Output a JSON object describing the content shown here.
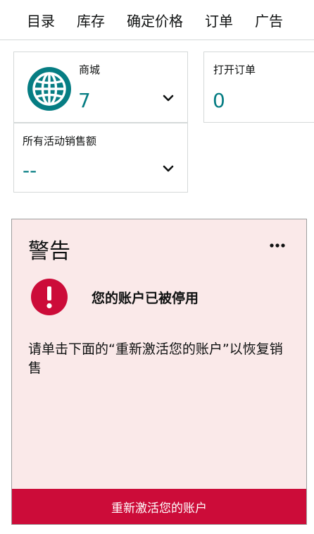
{
  "nav": {
    "items": [
      {
        "label": "目录"
      },
      {
        "label": "库存"
      },
      {
        "label": "确定价格"
      },
      {
        "label": "订单"
      },
      {
        "label": "广告"
      }
    ]
  },
  "cards": {
    "stores": {
      "label": "商城",
      "value": "7",
      "icon": "globe-icon"
    },
    "open_orders": {
      "label": "打开订单",
      "value": "0"
    },
    "sales": {
      "label": "所有活动销售额",
      "value": "--"
    }
  },
  "alert": {
    "title": "警告",
    "message": "您的账户已被停用",
    "body": "请单击下面的“重新激活您的账户”以恢复销售",
    "button_label": "重新激活您的账户"
  },
  "colors": {
    "accent_teal": "#067d83",
    "alert_bg": "#fae9e9",
    "danger": "#cc0c39"
  }
}
